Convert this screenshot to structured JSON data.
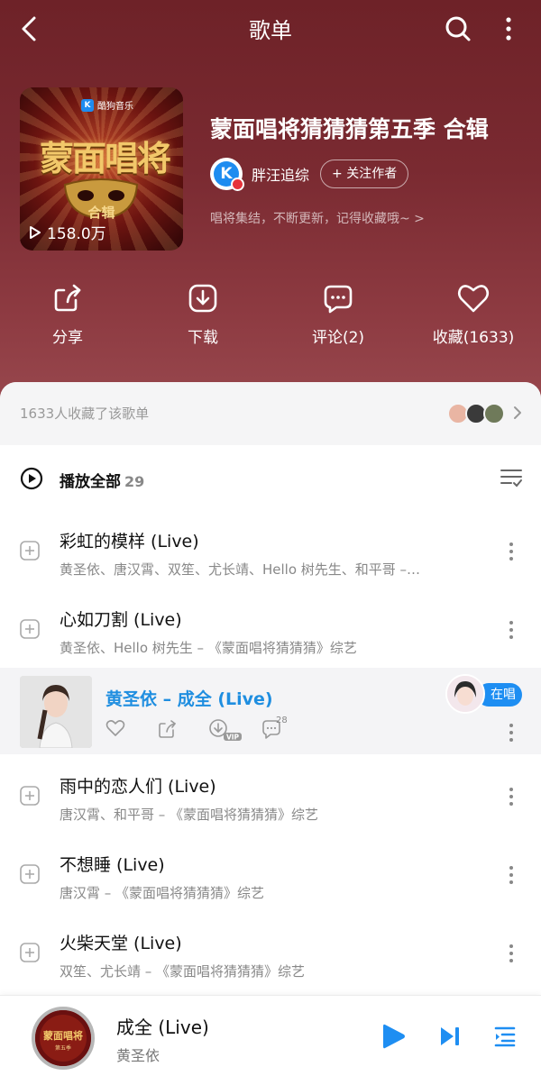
{
  "header": {
    "title": "歌单"
  },
  "cover": {
    "brand": "酷狗音乐",
    "logo_text": "蒙面唱将",
    "tag": "合辑",
    "play_count": "158.0万"
  },
  "playlist": {
    "title": "蒙面唱将猜猜猜第五季 合辑",
    "author": "胖汪追综",
    "follow_label": "+ 关注作者",
    "description": "唱将集结，不断更新，记得收藏哦~ >"
  },
  "actions": [
    {
      "label": "分享",
      "icon": "share-icon"
    },
    {
      "label": "下载",
      "icon": "download-icon"
    },
    {
      "label": "评论(2)",
      "icon": "comment-icon"
    },
    {
      "label": "收藏(1633)",
      "icon": "heart-icon"
    }
  ],
  "favorites": {
    "text": "1633人收藏了该歌单"
  },
  "play_all": {
    "label": "播放全部",
    "count": "29"
  },
  "songs": [
    {
      "name": "彩虹的模样 (Live)",
      "sub": "黄圣依、唐汉霄、双笙、尤长靖、Hello 树先生、和平哥 –…"
    },
    {
      "name": "心如刀割 (Live)",
      "sub": "黄圣依、Hello 树先生 – 《蒙面唱将猜猜猜》综艺"
    },
    {
      "name": "雨中的恋人们 (Live)",
      "sub": "唐汉霄、和平哥 – 《蒙面唱将猜猜猜》综艺"
    },
    {
      "name": "不想睡 (Live)",
      "sub": "唐汉霄 – 《蒙面唱将猜猜猜》综艺"
    },
    {
      "name": "火柴天堂 (Live)",
      "sub": "双笙、尤长靖 – 《蒙面唱将猜猜猜》综艺"
    }
  ],
  "active_song": {
    "name": "黄圣依 – 成全 (Live)",
    "comment_count": "28",
    "live_label": "在唱",
    "vip_label": "VIP"
  },
  "player": {
    "title": "成全 (Live)",
    "artist": "黄圣依",
    "disc_text": "蒙面唱将",
    "disc_sub": "第五季"
  },
  "colors": {
    "hero": "#7a2a31",
    "accent": "#1e8ef2",
    "active_bg": "#f4f4f6"
  }
}
